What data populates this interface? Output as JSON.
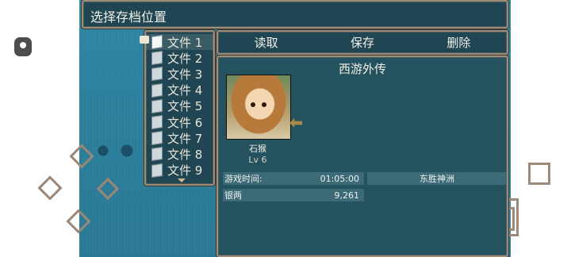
{
  "header": {
    "title": "选择存档位置"
  },
  "files": [
    {
      "label": "文件 1",
      "selected": true
    },
    {
      "label": "文件 2",
      "selected": false
    },
    {
      "label": "文件 3",
      "selected": false
    },
    {
      "label": "文件 4",
      "selected": false
    },
    {
      "label": "文件 5",
      "selected": false
    },
    {
      "label": "文件 6",
      "selected": false
    },
    {
      "label": "文件 7",
      "selected": false
    },
    {
      "label": "文件 8",
      "selected": false
    },
    {
      "label": "文件 9",
      "selected": false
    }
  ],
  "commands": {
    "load": "读取",
    "save": "保存",
    "delete": "删除"
  },
  "save_info": {
    "game_title": "西游外传",
    "character": {
      "name": "石猴",
      "level": "Lv 6"
    },
    "playtime_label": "游戏时间:",
    "playtime_value": "01:05:00",
    "location": "东胜神洲",
    "silver_label": "银两",
    "silver_value": "9,261"
  },
  "icons": {
    "file": "document-icon",
    "cursor": "hand-cursor-icon",
    "scroll": "chevron-down-icon",
    "overlay": "floating-assistant-icon"
  }
}
